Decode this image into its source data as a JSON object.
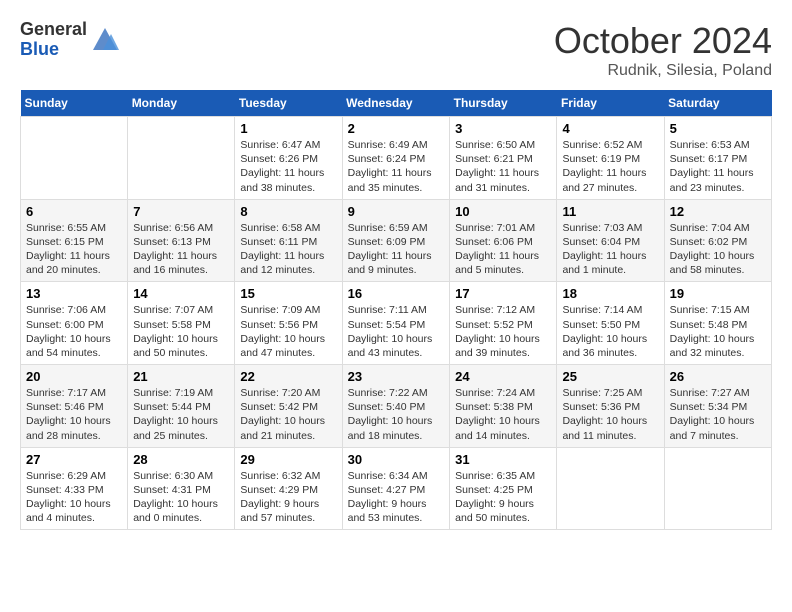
{
  "logo": {
    "general": "General",
    "blue": "Blue"
  },
  "title": "October 2024",
  "subtitle": "Rudnik, Silesia, Poland",
  "weekdays": [
    "Sunday",
    "Monday",
    "Tuesday",
    "Wednesday",
    "Thursday",
    "Friday",
    "Saturday"
  ],
  "rows": [
    [
      {
        "day": null,
        "info": null
      },
      {
        "day": null,
        "info": null
      },
      {
        "day": "1",
        "info": "Sunrise: 6:47 AM\nSunset: 6:26 PM\nDaylight: 11 hours and 38 minutes."
      },
      {
        "day": "2",
        "info": "Sunrise: 6:49 AM\nSunset: 6:24 PM\nDaylight: 11 hours and 35 minutes."
      },
      {
        "day": "3",
        "info": "Sunrise: 6:50 AM\nSunset: 6:21 PM\nDaylight: 11 hours and 31 minutes."
      },
      {
        "day": "4",
        "info": "Sunrise: 6:52 AM\nSunset: 6:19 PM\nDaylight: 11 hours and 27 minutes."
      },
      {
        "day": "5",
        "info": "Sunrise: 6:53 AM\nSunset: 6:17 PM\nDaylight: 11 hours and 23 minutes."
      }
    ],
    [
      {
        "day": "6",
        "info": "Sunrise: 6:55 AM\nSunset: 6:15 PM\nDaylight: 11 hours and 20 minutes."
      },
      {
        "day": "7",
        "info": "Sunrise: 6:56 AM\nSunset: 6:13 PM\nDaylight: 11 hours and 16 minutes."
      },
      {
        "day": "8",
        "info": "Sunrise: 6:58 AM\nSunset: 6:11 PM\nDaylight: 11 hours and 12 minutes."
      },
      {
        "day": "9",
        "info": "Sunrise: 6:59 AM\nSunset: 6:09 PM\nDaylight: 11 hours and 9 minutes."
      },
      {
        "day": "10",
        "info": "Sunrise: 7:01 AM\nSunset: 6:06 PM\nDaylight: 11 hours and 5 minutes."
      },
      {
        "day": "11",
        "info": "Sunrise: 7:03 AM\nSunset: 6:04 PM\nDaylight: 11 hours and 1 minute."
      },
      {
        "day": "12",
        "info": "Sunrise: 7:04 AM\nSunset: 6:02 PM\nDaylight: 10 hours and 58 minutes."
      }
    ],
    [
      {
        "day": "13",
        "info": "Sunrise: 7:06 AM\nSunset: 6:00 PM\nDaylight: 10 hours and 54 minutes."
      },
      {
        "day": "14",
        "info": "Sunrise: 7:07 AM\nSunset: 5:58 PM\nDaylight: 10 hours and 50 minutes."
      },
      {
        "day": "15",
        "info": "Sunrise: 7:09 AM\nSunset: 5:56 PM\nDaylight: 10 hours and 47 minutes."
      },
      {
        "day": "16",
        "info": "Sunrise: 7:11 AM\nSunset: 5:54 PM\nDaylight: 10 hours and 43 minutes."
      },
      {
        "day": "17",
        "info": "Sunrise: 7:12 AM\nSunset: 5:52 PM\nDaylight: 10 hours and 39 minutes."
      },
      {
        "day": "18",
        "info": "Sunrise: 7:14 AM\nSunset: 5:50 PM\nDaylight: 10 hours and 36 minutes."
      },
      {
        "day": "19",
        "info": "Sunrise: 7:15 AM\nSunset: 5:48 PM\nDaylight: 10 hours and 32 minutes."
      }
    ],
    [
      {
        "day": "20",
        "info": "Sunrise: 7:17 AM\nSunset: 5:46 PM\nDaylight: 10 hours and 28 minutes."
      },
      {
        "day": "21",
        "info": "Sunrise: 7:19 AM\nSunset: 5:44 PM\nDaylight: 10 hours and 25 minutes."
      },
      {
        "day": "22",
        "info": "Sunrise: 7:20 AM\nSunset: 5:42 PM\nDaylight: 10 hours and 21 minutes."
      },
      {
        "day": "23",
        "info": "Sunrise: 7:22 AM\nSunset: 5:40 PM\nDaylight: 10 hours and 18 minutes."
      },
      {
        "day": "24",
        "info": "Sunrise: 7:24 AM\nSunset: 5:38 PM\nDaylight: 10 hours and 14 minutes."
      },
      {
        "day": "25",
        "info": "Sunrise: 7:25 AM\nSunset: 5:36 PM\nDaylight: 10 hours and 11 minutes."
      },
      {
        "day": "26",
        "info": "Sunrise: 7:27 AM\nSunset: 5:34 PM\nDaylight: 10 hours and 7 minutes."
      }
    ],
    [
      {
        "day": "27",
        "info": "Sunrise: 6:29 AM\nSunset: 4:33 PM\nDaylight: 10 hours and 4 minutes."
      },
      {
        "day": "28",
        "info": "Sunrise: 6:30 AM\nSunset: 4:31 PM\nDaylight: 10 hours and 0 minutes."
      },
      {
        "day": "29",
        "info": "Sunrise: 6:32 AM\nSunset: 4:29 PM\nDaylight: 9 hours and 57 minutes."
      },
      {
        "day": "30",
        "info": "Sunrise: 6:34 AM\nSunset: 4:27 PM\nDaylight: 9 hours and 53 minutes."
      },
      {
        "day": "31",
        "info": "Sunrise: 6:35 AM\nSunset: 4:25 PM\nDaylight: 9 hours and 50 minutes."
      },
      {
        "day": null,
        "info": null
      },
      {
        "day": null,
        "info": null
      }
    ]
  ]
}
